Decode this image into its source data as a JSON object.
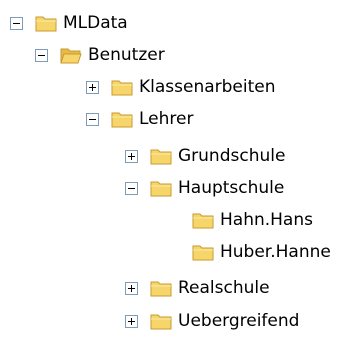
{
  "tree": {
    "root": {
      "label": "MLData",
      "expanded": true,
      "icon": "folder-closed-icon"
    },
    "benutzer": {
      "label": "Benutzer",
      "expanded": true,
      "icon": "folder-open-icon"
    },
    "klassenarbeiten": {
      "label": "Klassenarbeiten",
      "expanded": false,
      "icon": "folder-closed-icon"
    },
    "lehrer": {
      "label": "Lehrer",
      "expanded": true,
      "icon": "folder-closed-icon"
    },
    "grundschule": {
      "label": "Grundschule",
      "expanded": false,
      "icon": "folder-closed-icon"
    },
    "hauptschule": {
      "label": "Hauptschule",
      "expanded": true,
      "icon": "folder-closed-icon"
    },
    "hahn_hans": {
      "label": "Hahn.Hans",
      "icon": "folder-closed-icon"
    },
    "huber_hanne": {
      "label": "Huber.Hanne",
      "icon": "folder-closed-icon"
    },
    "realschule": {
      "label": "Realschule",
      "expanded": false,
      "icon": "folder-closed-icon"
    },
    "uebergreifend": {
      "label": "Uebergreifend",
      "expanded": false,
      "icon": "folder-closed-icon"
    }
  },
  "colors": {
    "folder_fill": "#f6d66b",
    "folder_edge": "#c99a2e",
    "toggle_border": "#7f9db9",
    "background": "#ffffff"
  }
}
